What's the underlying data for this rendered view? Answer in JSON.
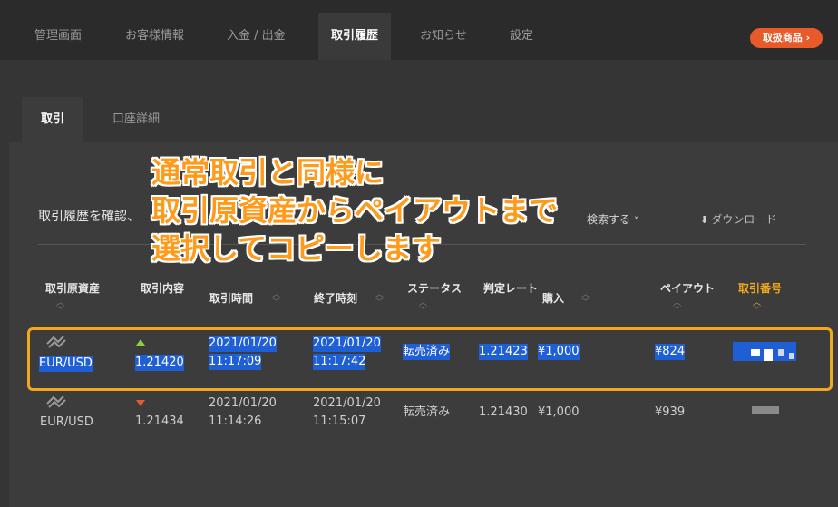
{
  "nav": {
    "items": [
      "管理画面",
      "お客様情報",
      "入金 / 出金",
      "取引履歴",
      "お知らせ",
      "設定"
    ],
    "product_button": "取扱商品 ›"
  },
  "subtabs": [
    "取引",
    "口座詳細"
  ],
  "panel": {
    "description": "取引履歴を確認、",
    "search_label": "検索する ˣ",
    "download_label": "ダウンロード"
  },
  "table": {
    "headers": [
      "取引原資産",
      "取引内容",
      "取引時間",
      "終了時刻",
      "ステータス",
      "判定レート",
      "購入",
      "ペイアウト",
      "取引番号"
    ],
    "rows": [
      {
        "asset": "EUR/USD",
        "direction": "up",
        "rate": "1.21420",
        "start_date": "2021/01/20",
        "start_time": "11:17:09",
        "end_date": "2021/01/20",
        "end_time": "11:17:42",
        "status": "転売済み",
        "judge_rate": "1.21423",
        "purchase": "¥1,000",
        "payout": "¥824",
        "selected": true
      },
      {
        "asset": "EUR/USD",
        "direction": "down",
        "rate": "1.21434",
        "start_date": "2021/01/20",
        "start_time": "11:14:26",
        "end_date": "2021/01/20",
        "end_time": "11:15:07",
        "status": "転売済み",
        "judge_rate": "1.21430",
        "purchase": "¥1,000",
        "payout": "¥939",
        "selected": false
      }
    ]
  },
  "overlay": {
    "line1": "通常取引と同様に",
    "line2": "取引原資産からペイアウトまで",
    "line3": "選択してコピーします"
  },
  "colors": {
    "accent": "#f2a81d",
    "selection": "#1f5fd6",
    "overlay_text": "#ff9a1a",
    "product_button": "#e85a2a"
  }
}
